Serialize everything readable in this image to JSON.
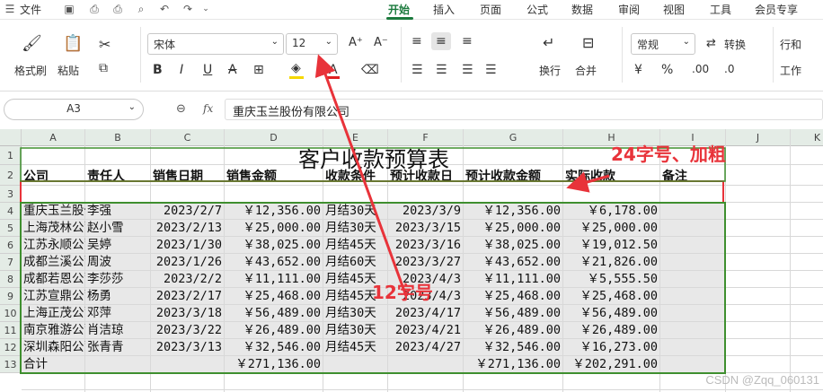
{
  "menu": {
    "file": "文件",
    "tabs": [
      "开始",
      "插入",
      "页面",
      "公式",
      "数据",
      "审阅",
      "视图",
      "工具",
      "会员专享"
    ],
    "active_tab": "开始"
  },
  "ribbon": {
    "format_painter": "格式刷",
    "paste": "粘贴",
    "font_name": "宋体",
    "font_size": "12",
    "bold": "B",
    "italic": "I",
    "underline": "U",
    "wrap": "换行",
    "merge": "合并",
    "number_format": "常规",
    "convert": "转换",
    "row_col": "行和",
    "worksheet": "工作",
    "currency": "¥"
  },
  "formula_bar": {
    "cell_ref": "A3",
    "fx": "fx",
    "content": "重庆玉兰股份有限公司"
  },
  "sheet": {
    "columns": [
      "A",
      "B",
      "C",
      "D",
      "E",
      "F",
      "G",
      "H",
      "I",
      "J",
      "K"
    ],
    "rows": [
      "1",
      "2",
      "3",
      "4",
      "5",
      "6",
      "7",
      "8",
      "9",
      "10",
      "11",
      "12",
      "13"
    ],
    "title": "客户收款预算表",
    "headers": [
      "公司",
      "责任人",
      "销售日期",
      "销售金额",
      "收款条件",
      "预计收款日",
      "预计收款金额",
      "实际收款",
      "备注"
    ],
    "data": [
      [
        "重庆玉兰股份有限公司",
        "李强",
        "2023/2/7",
        "￥12,356.00",
        "月结30天",
        "2023/3/9",
        "￥12,356.00",
        "￥6,178.00",
        ""
      ],
      [
        "上海茂林公司",
        "赵小雪",
        "2023/2/13",
        "￥25,000.00",
        "月结30天",
        "2023/3/15",
        "￥25,000.00",
        "￥25,000.00",
        ""
      ],
      [
        "江苏永顺公司",
        "吴婷",
        "2023/1/30",
        "￥38,025.00",
        "月结45天",
        "2023/3/16",
        "￥38,025.00",
        "￥19,012.50",
        ""
      ],
      [
        "成都兰溪公司",
        "周波",
        "2023/1/26",
        "￥43,652.00",
        "月结60天",
        "2023/3/27",
        "￥43,652.00",
        "￥21,826.00",
        ""
      ],
      [
        "成都若恩公司",
        "李莎莎",
        "2023/2/2",
        "￥11,111.00",
        "月结45天",
        "2023/4/3",
        "￥11,111.00",
        "￥5,555.50",
        ""
      ],
      [
        "江苏宣鼎公司",
        "杨勇",
        "2023/2/17",
        "￥25,468.00",
        "月结45天",
        "2023/4/3",
        "￥25,468.00",
        "￥25,468.00",
        ""
      ],
      [
        "上海正茂公司",
        "邓萍",
        "2023/3/18",
        "￥56,489.00",
        "月结30天",
        "2023/4/17",
        "￥56,489.00",
        "￥56,489.00",
        ""
      ],
      [
        "南京雅游公司",
        "肖洁琼",
        "2023/3/22",
        "￥26,489.00",
        "月结30天",
        "2023/4/21",
        "￥26,489.00",
        "￥26,489.00",
        ""
      ],
      [
        "深圳森阳公司",
        "张青青",
        "2023/3/13",
        "￥32,546.00",
        "月结45天",
        "2023/4/27",
        "￥32,546.00",
        "￥16,273.00",
        ""
      ]
    ],
    "total": [
      "合计",
      "",
      "",
      "￥271,136.00",
      "",
      "",
      "￥271,136.00",
      "￥202,291.00",
      ""
    ]
  },
  "annotations": {
    "label_24": "24字号、加粗",
    "label_12": "12字号"
  },
  "colors": {
    "accent_green": "#1b7a3d",
    "annot_red": "#e8333a",
    "box_green": "#3f8f2f"
  },
  "watermark": "CSDN @Zqq_060131"
}
